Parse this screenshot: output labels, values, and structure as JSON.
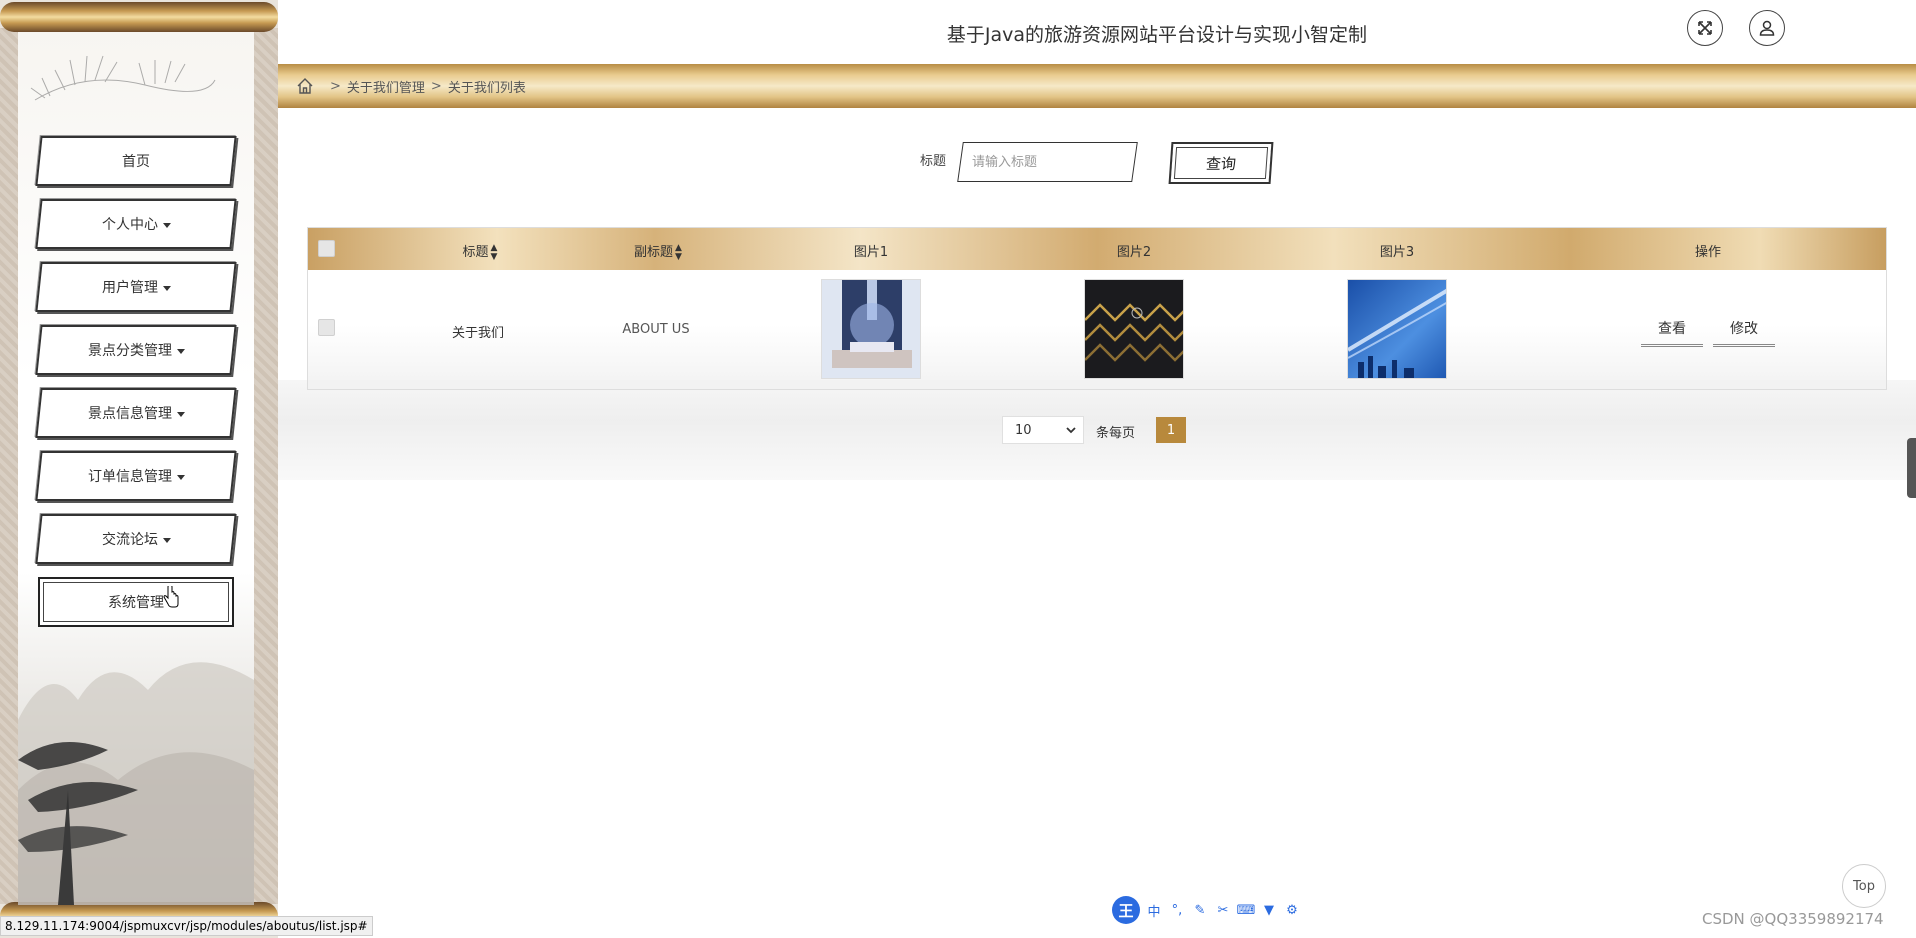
{
  "header": {
    "title": "基于Java的旅游资源网站平台设计与实现小智定制"
  },
  "breadcrumb": {
    "sep1": ">",
    "item1": "关于我们管理",
    "sep2": ">",
    "item2": "关于我们列表"
  },
  "sidebar": {
    "items": [
      {
        "label": "首页",
        "dropdown": false
      },
      {
        "label": "个人中心",
        "dropdown": true
      },
      {
        "label": "用户管理",
        "dropdown": true
      },
      {
        "label": "景点分类管理",
        "dropdown": true
      },
      {
        "label": "景点信息管理",
        "dropdown": true
      },
      {
        "label": "订单信息管理",
        "dropdown": true
      },
      {
        "label": "交流论坛",
        "dropdown": true
      },
      {
        "label": "系统管理",
        "dropdown": false
      }
    ]
  },
  "search": {
    "label": "标题",
    "placeholder": "请输入标题",
    "value": "",
    "button": "查询"
  },
  "table": {
    "headers": {
      "title": "标题",
      "subtitle": "副标题",
      "pic1": "图片1",
      "pic2": "图片2",
      "pic3": "图片3",
      "actions": "操作"
    },
    "rows": [
      {
        "title": "关于我们",
        "subtitle": "ABOUT US",
        "view": "查看",
        "edit": "修改"
      }
    ]
  },
  "pagination": {
    "page_size": "10",
    "page_size_label": "条每页",
    "current_page": "1"
  },
  "overlays": {
    "top_button": "Top",
    "ime_logo": "王",
    "ime_mode": "中",
    "watermark": "CSDN @QQ3359892174",
    "status_url": "8.129.11.174:9004/jspmuxcvr/jsp/modules/aboutus/list.jsp#"
  },
  "colors": {
    "accent_gold": "#b8893c",
    "ime_blue": "#2b6be0"
  }
}
